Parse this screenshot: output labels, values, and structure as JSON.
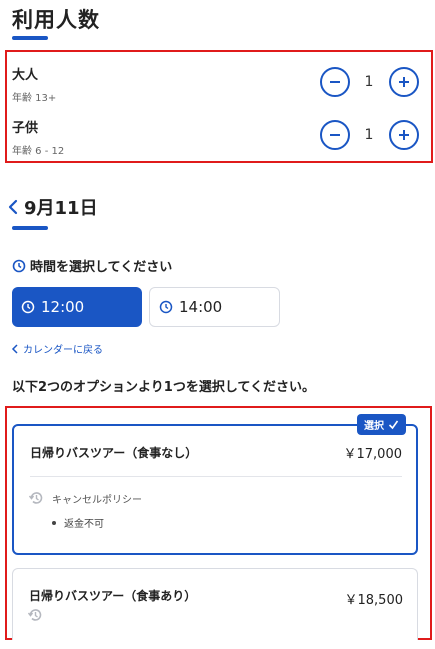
{
  "pax_section": {
    "title": "利用人数",
    "adult": {
      "label": "大人",
      "age": "年齢 13+",
      "count": "1"
    },
    "child": {
      "label": "子供",
      "age": "年齢 6 - 12",
      "count": "1"
    }
  },
  "date_section": {
    "date": "9月11日"
  },
  "time_section": {
    "heading": "時間を選択してください",
    "slots": [
      {
        "time": "12:00",
        "selected": true
      },
      {
        "time": "14:00",
        "selected": false
      }
    ],
    "back_link": "カレンダーに戻る"
  },
  "options_section": {
    "heading": "以下2つのオプションより1つを選択してください。",
    "selected_badge": "選択",
    "options": [
      {
        "name": "日帰りバスツアー（食事なし）",
        "price": "￥17,000",
        "policy_label": "キャンセルポリシー",
        "policy_item": "返金不可"
      },
      {
        "name": "日帰りバスツアー（食事あり）",
        "price": "￥18,500"
      }
    ]
  },
  "colors": {
    "accent": "#1a56c4",
    "highlight_box": "#e01b1b"
  }
}
